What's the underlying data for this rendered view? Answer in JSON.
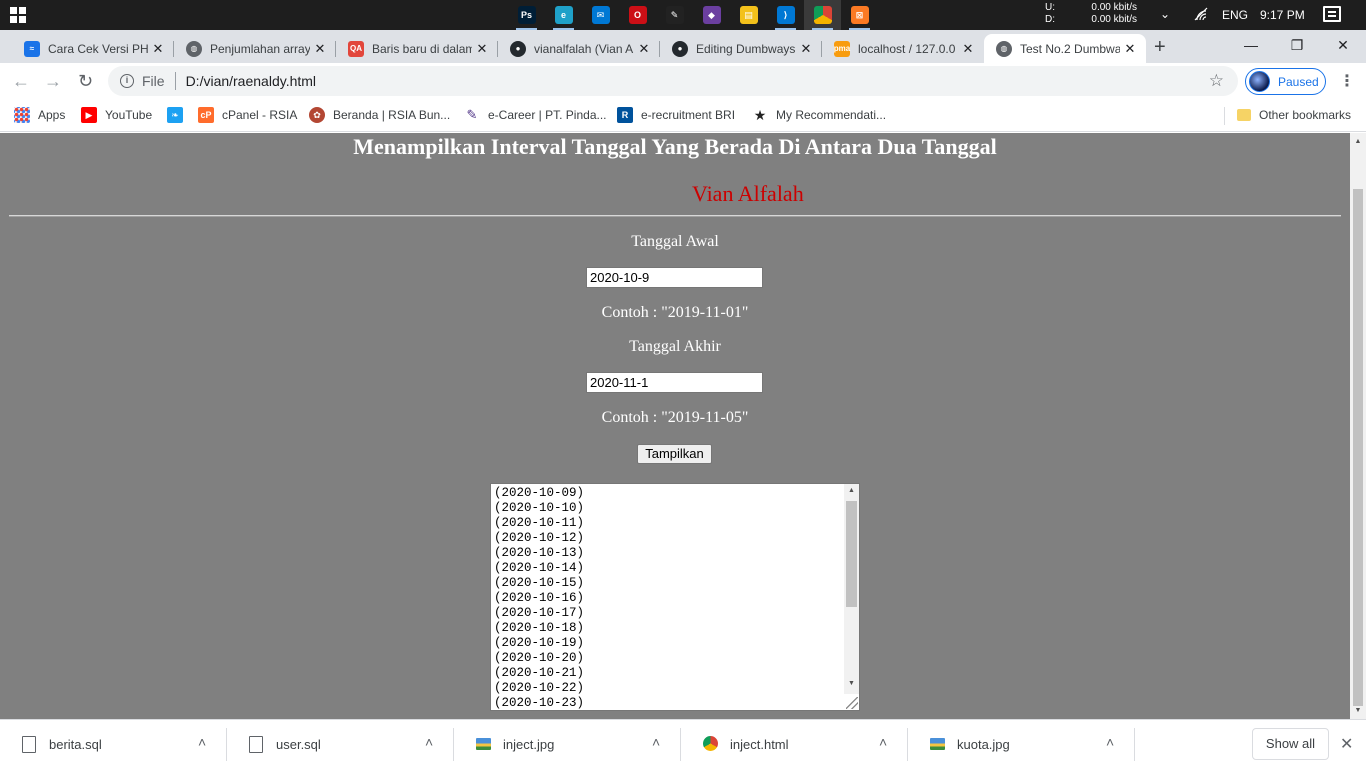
{
  "taskbar": {
    "apps": [
      {
        "name": "photoshop",
        "glyph": "Ps",
        "color": "#001e36"
      },
      {
        "name": "edge",
        "glyph": "e",
        "color": "#1fa1c9"
      },
      {
        "name": "mail",
        "glyph": "✉",
        "color": "#0078d4"
      },
      {
        "name": "opera",
        "glyph": "O",
        "color": "#cc0f16"
      },
      {
        "name": "inkscape",
        "glyph": "✎",
        "color": "#222222"
      },
      {
        "name": "store",
        "glyph": "◆",
        "color": "#6b3fa0"
      },
      {
        "name": "file-explorer",
        "glyph": "▤",
        "color": "#f3c11b"
      },
      {
        "name": "vscode",
        "glyph": "⟩",
        "color": "#0078d4"
      },
      {
        "name": "chrome",
        "glyph": "",
        "color": "#888888"
      },
      {
        "name": "xampp",
        "glyph": "⊠",
        "color": "#fb7a24"
      }
    ],
    "net_up_label": "U:",
    "net_up_value": "0.00 kbit/s",
    "net_down_label": "D:",
    "net_down_value": "0.00 kbit/s",
    "language": "ENG",
    "time": "9:17 PM"
  },
  "tabs": [
    {
      "title": "Cara Cek Versi PHP",
      "favicon_color": "#1a73e8",
      "favicon_glyph": "≈"
    },
    {
      "title": "Penjumlahan array",
      "favicon_color": "#5f6368",
      "favicon_glyph": "◍"
    },
    {
      "title": "Baris baru di dalam",
      "favicon_color": "#e2463b",
      "favicon_glyph": "QA"
    },
    {
      "title": "vianalfalah (Vian A",
      "favicon_color": "#24292e",
      "favicon_glyph": "●"
    },
    {
      "title": "Editing Dumbways",
      "favicon_color": "#24292e",
      "favicon_glyph": "●"
    },
    {
      "title": "localhost / 127.0.0",
      "favicon_color": "#f89c0e",
      "favicon_glyph": "pma"
    },
    {
      "title": "Test No.2 Dumbwa",
      "favicon_color": "#5f6368",
      "favicon_glyph": "◍"
    }
  ],
  "address": {
    "scheme_label": "File",
    "url": "D:/vian/raenaldy.html",
    "profile_status": "Paused"
  },
  "bookmarks": [
    {
      "label": "Apps",
      "icon": "apps-grid-icon"
    },
    {
      "label": "YouTube",
      "icon": "youtube-icon"
    },
    {
      "label": "",
      "icon": "twitter-icon"
    },
    {
      "label": "cPanel - RSIA",
      "icon": "cpanel-icon"
    },
    {
      "label": "Beranda | RSIA Bun...",
      "icon": "rsia-icon"
    },
    {
      "label": "e-Career | PT. Pinda...",
      "icon": "ecareer-icon"
    },
    {
      "label": "e-recruitment BRI",
      "icon": "bri-icon"
    },
    {
      "label": "My Recommendati...",
      "icon": "star-bookmark-icon"
    }
  ],
  "other_bookmarks": "Other bookmarks",
  "page": {
    "title": "Menampilkan Interval Tanggal Yang Berada Di Antara Dua Tanggal",
    "author": "Vian Alfalah",
    "start_label": "Tanggal Awal",
    "start_value": "2020-10-9",
    "start_example": "Contoh : \"2019-11-01\"",
    "end_label": "Tanggal Akhir",
    "end_value": "2020-11-1",
    "end_example": "Contoh : \"2019-11-05\"",
    "submit_label": "Tampilkan",
    "results": [
      "(2020-10-09)",
      "(2020-10-10)",
      "(2020-10-11)",
      "(2020-10-12)",
      "(2020-10-13)",
      "(2020-10-14)",
      "(2020-10-15)",
      "(2020-10-16)",
      "(2020-10-17)",
      "(2020-10-18)",
      "(2020-10-19)",
      "(2020-10-20)",
      "(2020-10-21)",
      "(2020-10-22)",
      "(2020-10-23)"
    ],
    "background_color": "#808080",
    "author_color": "#cc0000"
  },
  "downloads": [
    {
      "name": "berita.sql",
      "icon": "document-icon"
    },
    {
      "name": "user.sql",
      "icon": "document-icon"
    },
    {
      "name": "inject.jpg",
      "icon": "image-icon"
    },
    {
      "name": "inject.html",
      "icon": "chrome-file-icon"
    },
    {
      "name": "kuota.jpg",
      "icon": "image-icon"
    }
  ],
  "show_all_label": "Show all"
}
